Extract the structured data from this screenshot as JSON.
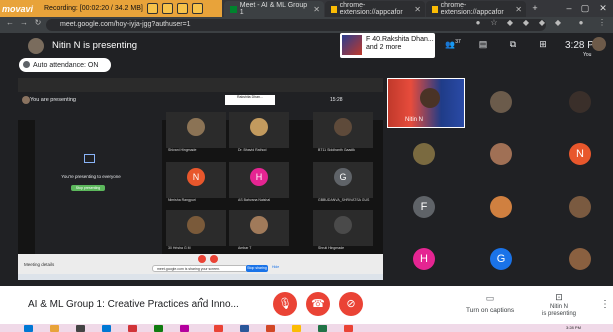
{
  "recorder": {
    "logo": "movavi",
    "status": "Recording: [00:02:20 / 34.2 MB]"
  },
  "browser": {
    "tabs": [
      {
        "label": "Meet - AI & ML Group 1",
        "active": true
      },
      {
        "label": "chrome-extension://appcafor",
        "active": false
      },
      {
        "label": "chrome-extension://appcafor",
        "active": false
      }
    ],
    "url": "meet.google.com/hoy-iyja-jgg?authuser=1"
  },
  "meet": {
    "presenting_title": "Nitin N is presenting",
    "attendance_label": "Auto attendance: ON",
    "speaker": {
      "line1": "F 40.Rakshita Dhan...",
      "line2": "and 2 more"
    },
    "people_count": "37",
    "clock": "3:28 PM",
    "you_label": "You"
  },
  "share": {
    "you_are_presenting": "You are presenting",
    "inner_speaker": "Rakshita Dhan...",
    "inner_clock": "15:28",
    "message": "You're presenting to everyone",
    "stop_button": "Stop presenting",
    "meeting_details": "Meeting details",
    "banner_text": "meet.google.com is sharing your screen.",
    "banner_stop": "Stop sharing",
    "banner_hide": "Hide",
    "tiles": [
      {
        "name": "Shivani Hingmade",
        "initial": "",
        "color": "#8b7355",
        "photo": true
      },
      {
        "name": "Dr. Bhavid Rathod",
        "initial": "",
        "color": "#c29a5e",
        "photo": true
      },
      {
        "name": "BT11 Siddhanth Gaadik",
        "initial": "",
        "color": "#5e4a3a",
        "photo": true
      },
      {
        "name": "Nimisha Rangpuri",
        "initial": "N",
        "color": "#e8572c",
        "photo": false
      },
      {
        "name": "AS Bahvana Naishal",
        "initial": "H",
        "color": "#e52592",
        "photo": false
      },
      {
        "name": "GBBUDANVA_SHRIVATSA GUS",
        "initial": "G",
        "color": "#5f6368",
        "photo": false
      },
      {
        "name": "30 Hrisha G M",
        "initial": "",
        "color": "#7a5a3a",
        "photo": true
      },
      {
        "name": "Ambar T",
        "initial": "",
        "color": "#a07a5a",
        "photo": true
      },
      {
        "name": "Shruti Hingmade",
        "initial": "",
        "color": "#4a4a4a",
        "photo": true
      }
    ]
  },
  "main_video": {
    "name": "Nitin N"
  },
  "grid": [
    {
      "initial": "",
      "color": "#6b5b4b",
      "photo": true
    },
    {
      "initial": "",
      "color": "#3a2f2a",
      "photo": true
    },
    {
      "initial": "",
      "color": "#7a6a40",
      "photo": true
    },
    {
      "initial": "",
      "color": "#a07055",
      "photo": true
    },
    {
      "initial": "N",
      "color": "#e8572c",
      "photo": false
    },
    {
      "initial": "F",
      "color": "#5f6368",
      "photo": false
    },
    {
      "initial": "",
      "color": "#d08040",
      "photo": true
    },
    {
      "initial": "",
      "color": "#7a5a40",
      "photo": true
    },
    {
      "initial": "H",
      "color": "#e52592",
      "photo": false
    },
    {
      "initial": "G",
      "color": "#1a73e8",
      "photo": false
    },
    {
      "initial": "",
      "color": "#8a6040",
      "photo": true
    }
  ],
  "controls": {
    "meeting_title": "AI & ML Group 1: Creative Practices and Inno...",
    "captions": "Turn on captions",
    "presenting_line1": "Nitin N",
    "presenting_line2": "is presenting"
  },
  "taskbar": {
    "time": "3:28 PM",
    "date": "4/10/2021"
  }
}
